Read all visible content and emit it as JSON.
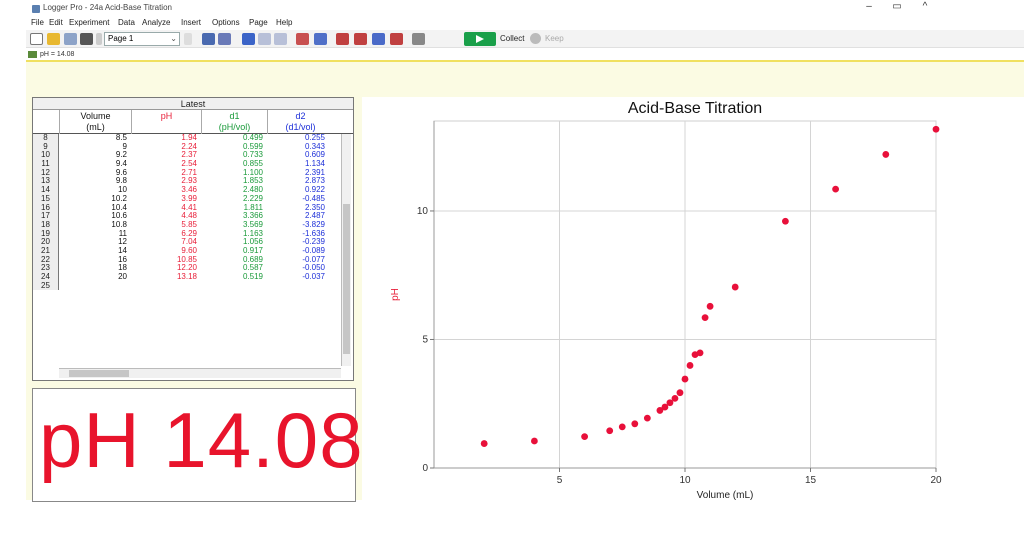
{
  "window": {
    "title": "Logger Pro - 24a Acid-Base Titration",
    "controls": [
      "–",
      "▭",
      "^"
    ]
  },
  "menu": [
    "File",
    "Edit",
    "Experiment",
    "Data",
    "Analyze",
    "Insert",
    "Options",
    "Page",
    "Help"
  ],
  "toolbar": {
    "page_select": "Page 1",
    "collect_label": "Collect",
    "keep_label": "Keep"
  },
  "status": {
    "text": "pH = 14.08"
  },
  "table": {
    "group_header": "Latest",
    "columns": [
      {
        "name": "Volume",
        "unit": "(mL)"
      },
      {
        "name": "pH",
        "unit": ""
      },
      {
        "name": "d1",
        "unit": "(pH/vol)"
      },
      {
        "name": "d2",
        "unit": "(d1/vol)"
      }
    ],
    "rows": [
      {
        "n": "8",
        "volume": "8.5",
        "ph": "1.94",
        "d1": "0.499",
        "d2": "0.255"
      },
      {
        "n": "9",
        "volume": "9",
        "ph": "2.24",
        "d1": "0.599",
        "d2": "0.343"
      },
      {
        "n": "10",
        "volume": "9.2",
        "ph": "2.37",
        "d1": "0.733",
        "d2": "0.609"
      },
      {
        "n": "11",
        "volume": "9.4",
        "ph": "2.54",
        "d1": "0.855",
        "d2": "1.134"
      },
      {
        "n": "12",
        "volume": "9.6",
        "ph": "2.71",
        "d1": "1.100",
        "d2": "2.391"
      },
      {
        "n": "13",
        "volume": "9.8",
        "ph": "2.93",
        "d1": "1.853",
        "d2": "2.873"
      },
      {
        "n": "14",
        "volume": "10",
        "ph": "3.46",
        "d1": "2.480",
        "d2": "0.922"
      },
      {
        "n": "15",
        "volume": "10.2",
        "ph": "3.99",
        "d1": "2.229",
        "d2": "-0.485"
      },
      {
        "n": "16",
        "volume": "10.4",
        "ph": "4.41",
        "d1": "1.811",
        "d2": "2.350"
      },
      {
        "n": "17",
        "volume": "10.6",
        "ph": "4.48",
        "d1": "3.366",
        "d2": "2.487"
      },
      {
        "n": "18",
        "volume": "10.8",
        "ph": "5.85",
        "d1": "3.569",
        "d2": "-3.829"
      },
      {
        "n": "19",
        "volume": "11",
        "ph": "6.29",
        "d1": "1.163",
        "d2": "-1.636"
      },
      {
        "n": "20",
        "volume": "12",
        "ph": "7.04",
        "d1": "1.056",
        "d2": "-0.239"
      },
      {
        "n": "21",
        "volume": "14",
        "ph": "9.60",
        "d1": "0.917",
        "d2": "-0.089"
      },
      {
        "n": "22",
        "volume": "16",
        "ph": "10.85",
        "d1": "0.689",
        "d2": "-0.077"
      },
      {
        "n": "23",
        "volume": "18",
        "ph": "12.20",
        "d1": "0.587",
        "d2": "-0.050"
      },
      {
        "n": "24",
        "volume": "20",
        "ph": "13.18",
        "d1": "0.519",
        "d2": "-0.037"
      },
      {
        "n": "25",
        "volume": "",
        "ph": "",
        "d1": "",
        "d2": ""
      }
    ]
  },
  "meter": {
    "text": "pH 14.08"
  },
  "colors": {
    "ph": "#e8203a",
    "d1": "#1a9a3a",
    "d2": "#1d2fd8",
    "points": "#e8103a",
    "pane_bg": "#fbfbe3"
  },
  "chart_data": {
    "type": "scatter",
    "title": "Acid-Base Titration",
    "xlabel": "Volume (mL)",
    "ylabel": "pH",
    "xlim": [
      0,
      20
    ],
    "ylim": [
      0,
      13.5
    ],
    "xticks": [
      5,
      10,
      15,
      20
    ],
    "yticks": [
      0,
      5,
      10
    ],
    "grid": true,
    "series": [
      {
        "x": [
          2,
          4,
          6,
          7,
          7.5,
          8,
          8.5,
          9,
          9.2,
          9.4,
          9.6,
          9.8,
          10,
          10.2,
          10.4,
          10.6,
          10.8,
          11,
          12,
          14,
          16,
          18,
          20
        ],
        "y": [
          0.95,
          1.05,
          1.22,
          1.45,
          1.6,
          1.72,
          1.94,
          2.24,
          2.37,
          2.54,
          2.71,
          2.93,
          3.46,
          3.99,
          4.41,
          4.48,
          5.85,
          6.29,
          7.04,
          9.6,
          10.85,
          12.2,
          13.18
        ]
      }
    ]
  }
}
